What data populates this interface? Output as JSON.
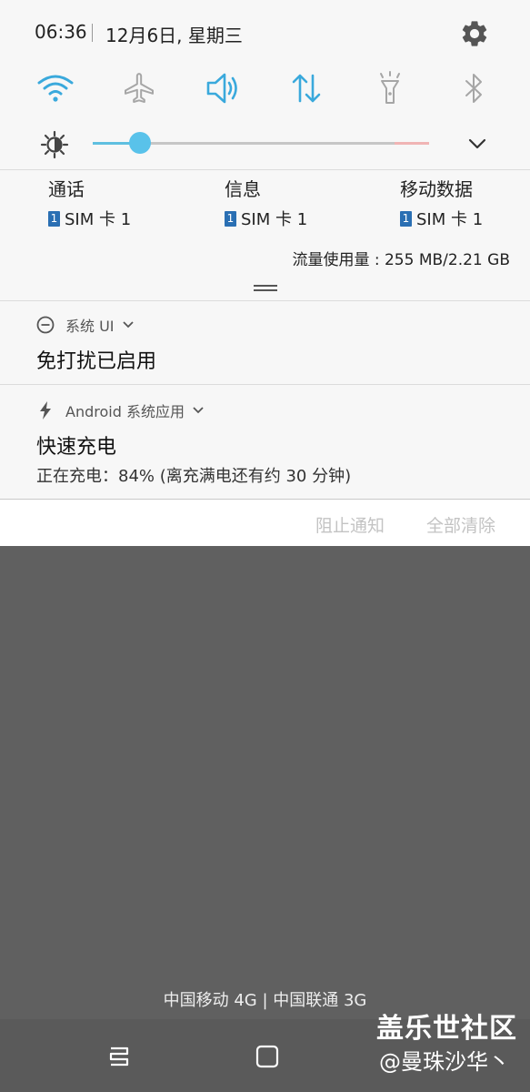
{
  "status": {
    "time": "06:36",
    "date": "12月6日, 星期三",
    "settings_icon": "gear-icon"
  },
  "quick_settings": [
    {
      "name": "wifi",
      "icon": "wifi-icon",
      "active": true
    },
    {
      "name": "airplane",
      "icon": "airplane-icon",
      "active": false
    },
    {
      "name": "sound",
      "icon": "speaker-icon",
      "active": true
    },
    {
      "name": "mobile-data",
      "icon": "data-arrows-icon",
      "active": true
    },
    {
      "name": "flashlight",
      "icon": "flashlight-icon",
      "active": false
    },
    {
      "name": "bluetooth",
      "icon": "bluetooth-icon",
      "active": false
    }
  ],
  "brightness": {
    "level_fraction": 0.14,
    "icon": "brightness-icon"
  },
  "sims": [
    {
      "title": "通话",
      "chip": "1",
      "label": "SIM 卡 1"
    },
    {
      "title": "信息",
      "chip": "1",
      "label": "SIM 卡 1"
    },
    {
      "title": "移动数据",
      "chip": "1",
      "label": "SIM 卡 1"
    }
  ],
  "data_usage": "流量使用量 : 255 MB/2.21 GB",
  "notifications": [
    {
      "app": "系统 UI",
      "icon": "do-not-disturb-icon",
      "title": "免打扰已启用",
      "text": ""
    },
    {
      "app": "Android 系统应用",
      "icon": "charging-bolt-icon",
      "title": "快速充电",
      "text": "正在充电：84% (离充满电还有约 30 分钟)"
    }
  ],
  "actions": {
    "block": "阻止通知",
    "clear_all": "全部清除"
  },
  "carrier": "中国移动 4G | 中国联通 3G",
  "watermark": {
    "line1": "盖乐世社区",
    "line2": "@曼珠沙华丶"
  },
  "colors": {
    "accent": "#3aa9dc",
    "inactive": "#a6a6a6",
    "panel": "#f7f7f7",
    "scrim": "#606060"
  }
}
